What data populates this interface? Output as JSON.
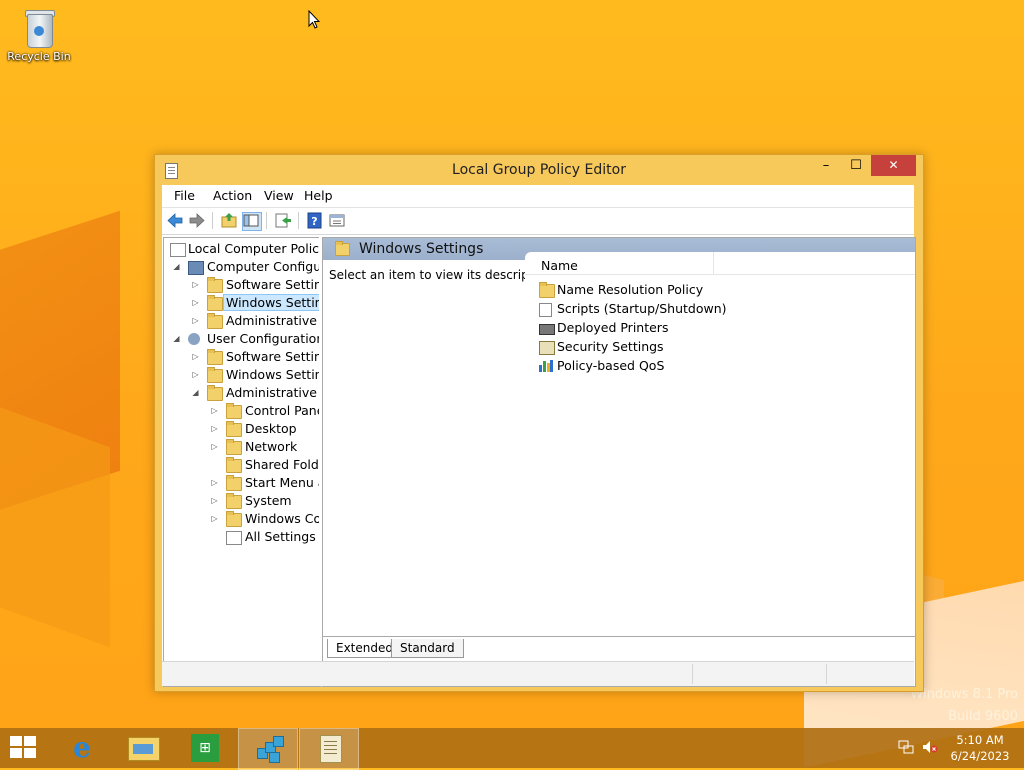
{
  "desktop": {
    "icons": [
      {
        "label": "Recycle Bin",
        "icon": "recycle-bin-icon"
      }
    ],
    "watermark": {
      "line1": "Windows 8.1 Pro",
      "line2": "Build 9600"
    }
  },
  "window": {
    "title": "Local Group Policy Editor",
    "controls": {
      "minimize": "–",
      "maximize": "☐",
      "close": "✕"
    },
    "menu": [
      "File",
      "Action",
      "View",
      "Help"
    ],
    "toolbar": [
      "back-icon",
      "forward-icon",
      "up-folder-icon",
      "show-hide-tree-icon",
      "export-list-icon",
      "help-icon",
      "properties-icon"
    ],
    "tree": {
      "root": "Local Computer Policy",
      "items": [
        {
          "label": "Computer Configura",
          "level": 1,
          "twisty": "open",
          "icon": "computer-icon"
        },
        {
          "label": "Software Settings",
          "level": 2,
          "twisty": "closed",
          "icon": "folder-icon"
        },
        {
          "label": "Windows Setting",
          "level": 2,
          "twisty": "closed",
          "icon": "folder-icon",
          "selected": true
        },
        {
          "label": "Administrative Te",
          "level": 2,
          "twisty": "closed",
          "icon": "folder-icon"
        },
        {
          "label": "User Configuration",
          "level": 1,
          "twisty": "open",
          "icon": "user-icon"
        },
        {
          "label": "Software Settings",
          "level": 2,
          "twisty": "closed",
          "icon": "folder-icon"
        },
        {
          "label": "Windows Setting",
          "level": 2,
          "twisty": "closed",
          "icon": "folder-icon"
        },
        {
          "label": "Administrative Te",
          "level": 2,
          "twisty": "open",
          "icon": "folder-icon"
        },
        {
          "label": "Control Panel",
          "level": 3,
          "twisty": "closed",
          "icon": "folder-icon"
        },
        {
          "label": "Desktop",
          "level": 3,
          "twisty": "closed",
          "icon": "folder-icon"
        },
        {
          "label": "Network",
          "level": 3,
          "twisty": "closed",
          "icon": "folder-icon"
        },
        {
          "label": "Shared Folder",
          "level": 3,
          "twisty": "none",
          "icon": "folder-icon"
        },
        {
          "label": "Start Menu ar",
          "level": 3,
          "twisty": "closed",
          "icon": "folder-icon"
        },
        {
          "label": "System",
          "level": 3,
          "twisty": "closed",
          "icon": "folder-icon"
        },
        {
          "label": "Windows Cor",
          "level": 3,
          "twisty": "closed",
          "icon": "folder-icon"
        },
        {
          "label": "All Settings",
          "level": 3,
          "twisty": "none",
          "icon": "settings-doc-icon"
        }
      ]
    },
    "pane": {
      "header": "Windows Settings",
      "description": "Select an item to view its description.",
      "column": "Name",
      "items": [
        {
          "label": "Name Resolution Policy",
          "icon": "folder-icon"
        },
        {
          "label": "Scripts (Startup/Shutdown)",
          "icon": "scripts-icon"
        },
        {
          "label": "Deployed Printers",
          "icon": "printer-icon"
        },
        {
          "label": "Security Settings",
          "icon": "security-icon"
        },
        {
          "label": "Policy-based QoS",
          "icon": "qos-chart-icon"
        }
      ],
      "tabs": [
        "Extended",
        "Standard"
      ]
    }
  },
  "taskbar": {
    "items": [
      "start-icon",
      "internet-explorer-icon",
      "file-explorer-icon",
      "store-icon",
      "group-policy-icon",
      "notepad-icon"
    ],
    "clock": {
      "time": "5:10 AM",
      "date": "6/24/2023"
    }
  },
  "colors": {
    "accent": "#ffae1a",
    "selection": "#cce8ff",
    "close_button": "#c7413c",
    "pane_header": "#a9bcd6"
  }
}
